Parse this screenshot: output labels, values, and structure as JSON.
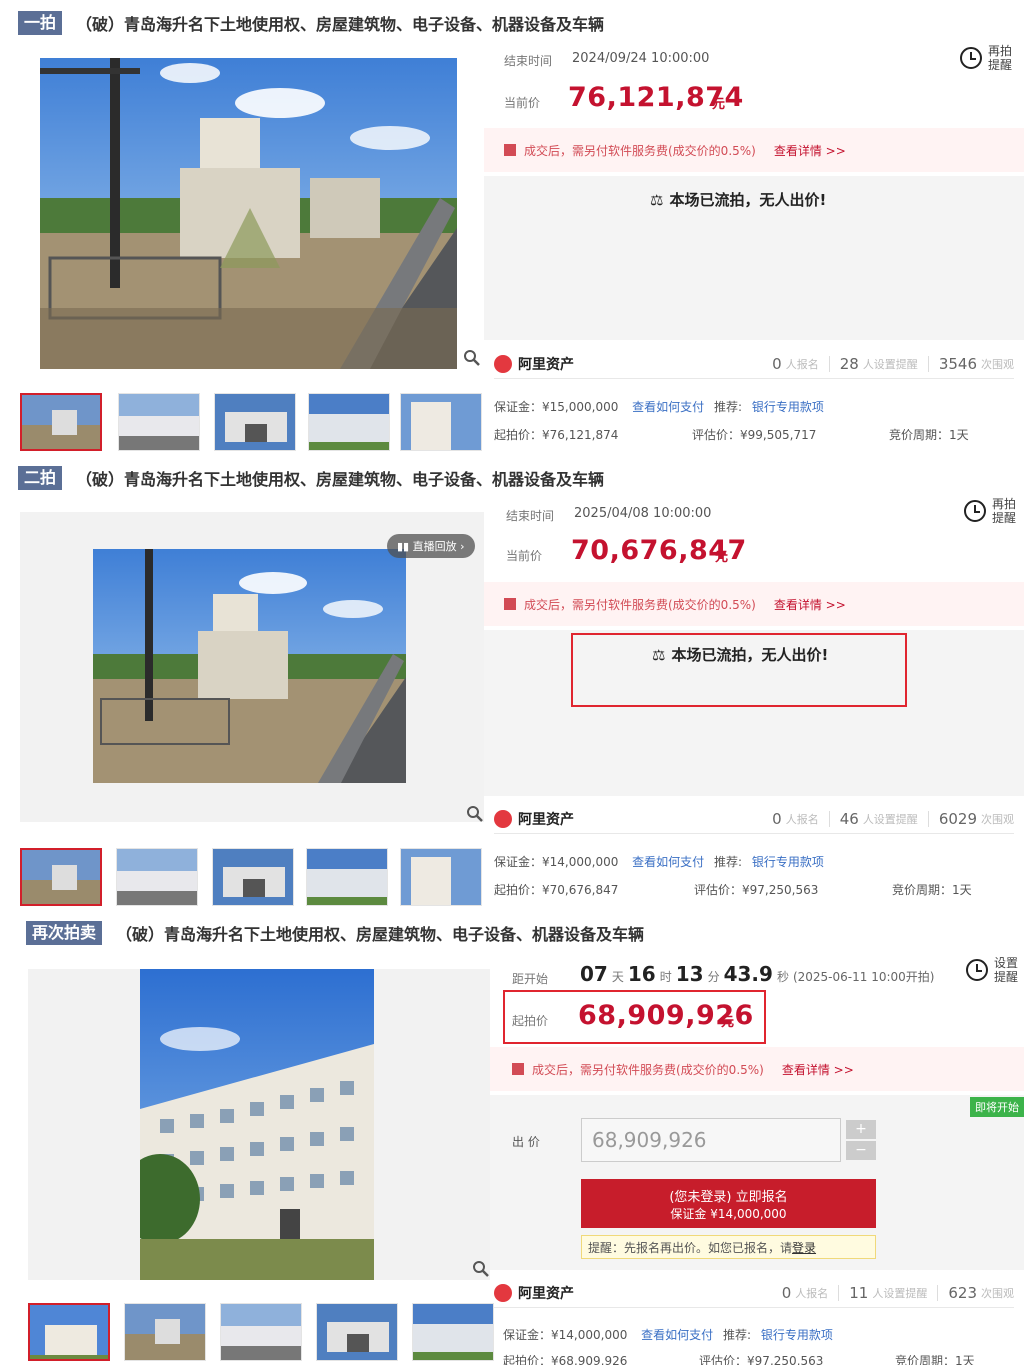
{
  "common": {
    "title": "（破）青岛海升名下土地使用权、房屋建筑物、电子设备、机器设备及车辆",
    "fee_notice": "成交后，需另付软件服务费(成交价的0.5%)",
    "fee_link": "查看详情 >>",
    "yuan": "元",
    "ali_brand": "阿里资产",
    "signup_unit": "人报名",
    "remind_unit": "人设置提醒",
    "view_unit": "次围观",
    "how_pay": "查看如何支付",
    "recommend_label": "推荐:",
    "bank_loan": "银行专用款项",
    "cycle": "竞价周期：1天",
    "flow_text": "本场已流拍，无人出价!"
  },
  "auction1": {
    "tag": "一拍",
    "end_label": "结束时间",
    "end_time": "2024/09/24 10:00:00",
    "price_label": "当前价",
    "price": "76,121,874",
    "remind_label_1": "再拍",
    "remind_label_2": "提醒",
    "signups": "0",
    "reminders": "28",
    "views": "3546",
    "deposit": "保证金：¥15,000,000",
    "start_price": "起拍价：¥76,121,874",
    "assess_price": "评估价：¥99,505,717"
  },
  "auction2": {
    "tag": "二拍",
    "end_label": "结束时间",
    "end_time": "2025/04/08 10:00:00",
    "price_label": "当前价",
    "price": "70,676,847",
    "remind_label_1": "再拍",
    "remind_label_2": "提醒",
    "live_replay": "直播回放",
    "signups": "0",
    "reminders": "46",
    "views": "6029",
    "deposit": "保证金：¥14,000,000",
    "start_price": "起拍价：¥70,676,847",
    "assess_price": "评估价：¥97,250,563"
  },
  "auction3": {
    "tag": "再次拍卖",
    "countdown_label": "距开始",
    "days": "07",
    "days_unit": "天",
    "hours": "16",
    "hours_unit": "时",
    "minutes": "13",
    "minutes_unit": "分",
    "seconds": "43.9",
    "seconds_unit": "秒",
    "start_at": "(2025-06-11 10:00开拍)",
    "remind_label_1": "设置",
    "remind_label_2": "提醒",
    "price_label": "起拍价",
    "price": "68,909,926",
    "badge": "即将开始",
    "bid_label": "出 价",
    "bid_placeholder": "68,909,926",
    "signup_line1": "(您未登录) 立即报名",
    "signup_line2": "保证金 ¥14,000,000",
    "tip": "提醒：先报名再出价。如您已报名，请",
    "tip_login": "登录",
    "signups": "0",
    "reminders": "11",
    "views": "623",
    "deposit": "保证金：¥14,000,000",
    "start_price": "起拍价：¥68,909,926",
    "assess_price": "评估价：¥97,250,563"
  }
}
